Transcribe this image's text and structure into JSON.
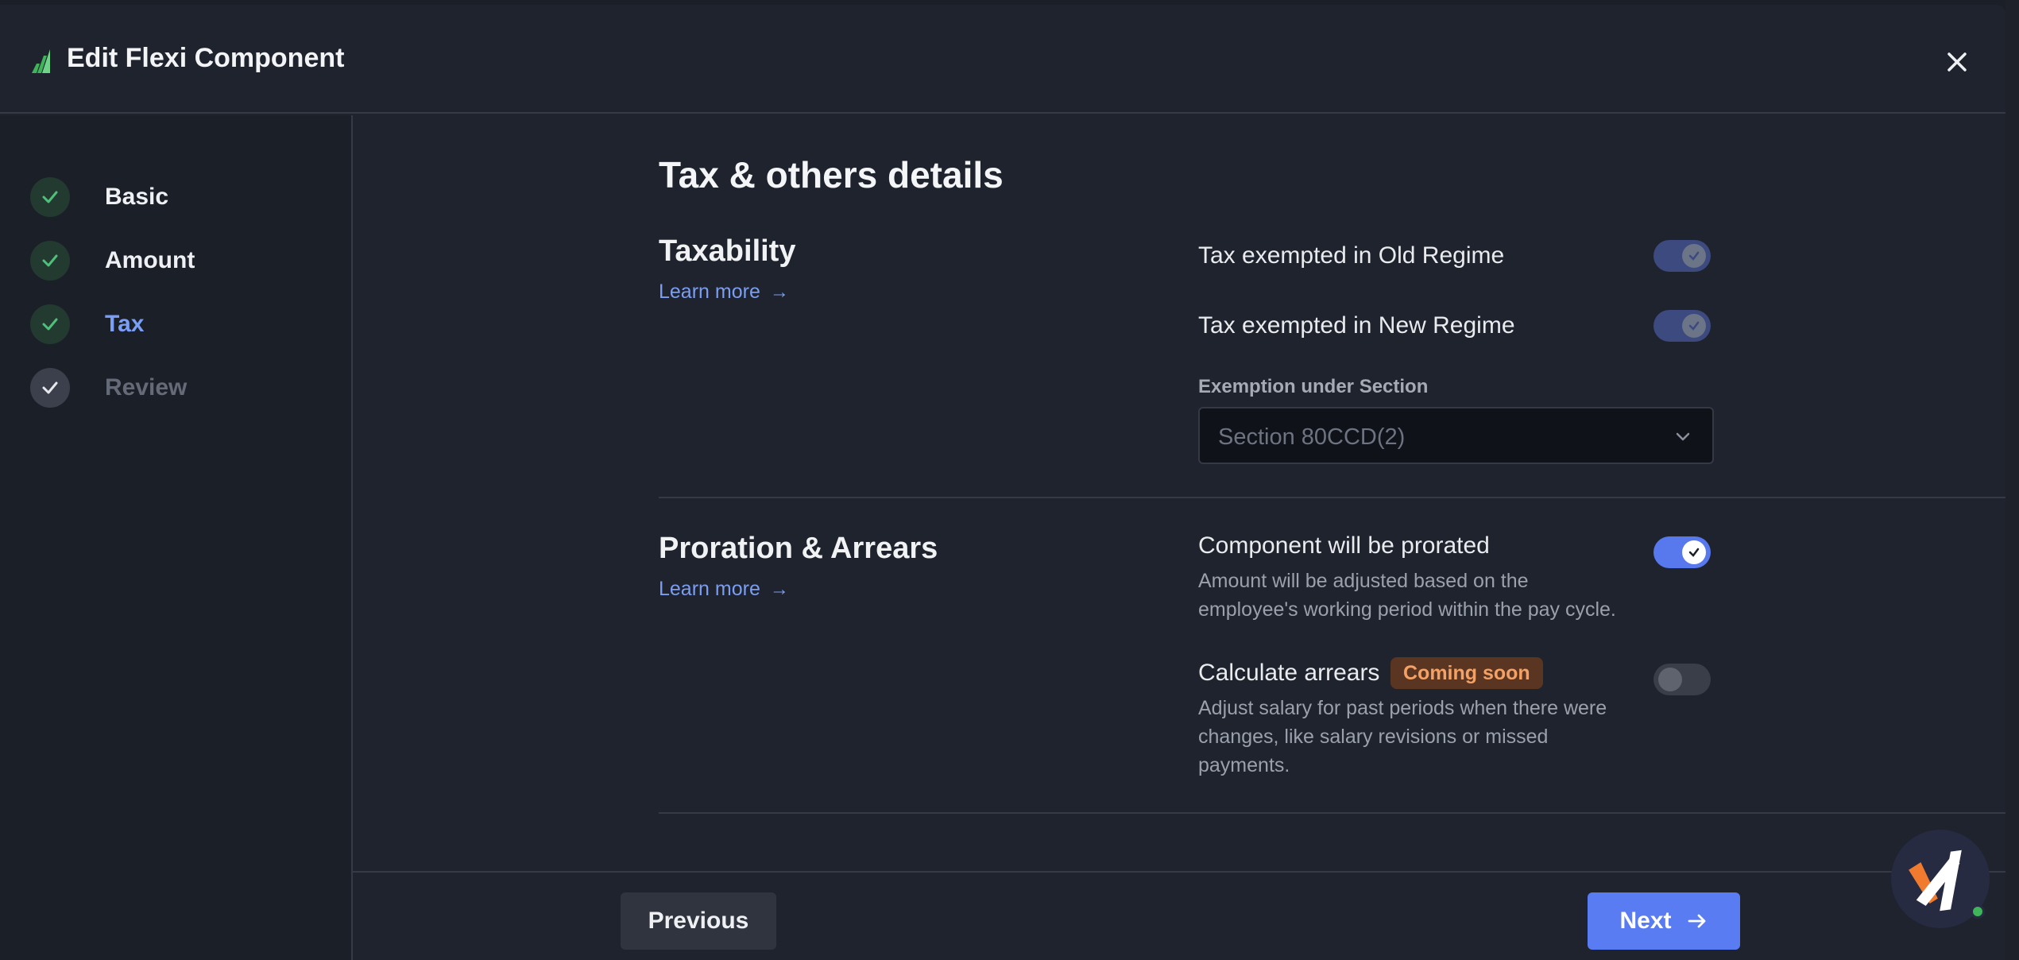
{
  "header": {
    "title": "Edit Flexi Component",
    "logo_icon": "brand-leaf-icon",
    "close_icon": "close-icon"
  },
  "steps": [
    {
      "label": "Basic",
      "status": "complete"
    },
    {
      "label": "Amount",
      "status": "complete"
    },
    {
      "label": "Tax",
      "status": "active"
    },
    {
      "label": "Review",
      "status": "pending"
    }
  ],
  "main": {
    "heading": "Tax & others details",
    "taxability": {
      "title": "Taxability",
      "learn_more": "Learn more",
      "old_regime_label": "Tax exempted in Old Regime",
      "old_regime_on": true,
      "new_regime_label": "Tax exempted in New Regime",
      "new_regime_on": true,
      "exemption_label": "Exemption under Section",
      "exemption_value": "Section 80CCD(2)"
    },
    "proration": {
      "title": "Proration & Arrears",
      "learn_more": "Learn more",
      "prorated_label": "Component will be prorated",
      "prorated_desc_1": "Amount will be adjusted based on the",
      "prorated_desc_2": "employee's working period within the pay cycle.",
      "prorated_on": true,
      "arrears_label": "Calculate arrears",
      "arrears_badge": "Coming soon",
      "arrears_desc_1": "Adjust salary for past periods when there were",
      "arrears_desc_2": "changes, like salary revisions or missed",
      "arrears_desc_3": "payments.",
      "arrears_on": false
    }
  },
  "footer": {
    "previous_label": "Previous",
    "next_label": "Next"
  },
  "colors": {
    "accent": "#5a7cf2",
    "success": "#4fbf7a",
    "badge_text": "#f3a165"
  }
}
